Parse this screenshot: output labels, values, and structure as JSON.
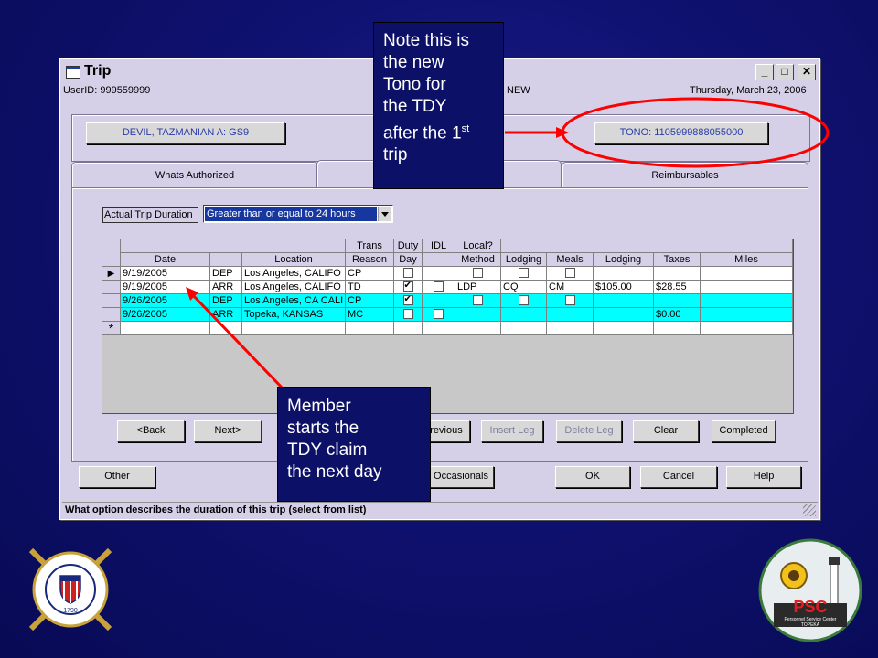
{
  "window": {
    "title": "Trip",
    "user_id": "UserID: 999559999",
    "mode_text": "NEW",
    "date_text": "Thursday, March 23, 2006",
    "member_button": "DEVIL, TAZMANIAN A: GS9",
    "tono_button": "TONO: 1105999888055000",
    "tabs": [
      "Whats Authorized",
      "",
      "Reimbursables"
    ],
    "duration_label": "Actual Trip Duration",
    "duration_value": "Greater than or equal to 24 hours",
    "status_text": "What option describes the duration of this trip (select from list)"
  },
  "grid": {
    "group_headers": {
      "trans": "Trans",
      "duty": "Duty",
      "idl": "IDL",
      "local": "Local?"
    },
    "columns": [
      "Date",
      "",
      "Location",
      "Reason",
      "Day",
      "",
      "Method",
      "Lodging",
      "Meals",
      "Lodging",
      "Taxes",
      "Miles"
    ],
    "rows": [
      {
        "date": "9/19/2005",
        "type": "DEP",
        "location": "Los Angeles,  CALIFO",
        "reason": "CP",
        "duty": false,
        "idl": false,
        "method": "",
        "lodging": "",
        "meals": "",
        "lodging_amt": "",
        "taxes": "",
        "miles": "",
        "checks": [
          false,
          null,
          false,
          false,
          false
        ],
        "highlight": false,
        "current": true
      },
      {
        "date": "9/19/2005",
        "type": "ARR",
        "location": "Los Angeles,  CALIFO",
        "reason": "TD",
        "duty": true,
        "idl": false,
        "method": "LDP",
        "lodging": "CQ",
        "meals": "CM",
        "lodging_amt": "$105.00",
        "taxes": "$28.55",
        "miles": "",
        "checks": [
          true,
          false,
          null,
          null,
          null
        ],
        "highlight": false,
        "current": false
      },
      {
        "date": "9/26/2005",
        "type": "DEP",
        "location": "Los Angeles, CA CALI",
        "reason": "CP",
        "duty": true,
        "idl": false,
        "method": "",
        "lodging": "",
        "meals": "",
        "lodging_amt": "",
        "taxes": "",
        "miles": "",
        "checks": [
          true,
          null,
          false,
          false,
          false
        ],
        "highlight": true,
        "current": false
      },
      {
        "date": "9/26/2005",
        "type": "ARR",
        "location": "Topeka,  KANSAS",
        "reason": "MC",
        "duty": false,
        "idl": false,
        "method": "",
        "lodging": "",
        "meals": "",
        "lodging_amt": "",
        "taxes": "$0.00",
        "miles": "",
        "checks": [
          false,
          false,
          null,
          null,
          null
        ],
        "highlight": true,
        "current": false
      }
    ],
    "new_row_marker": "*",
    "current_row_marker": "▶"
  },
  "nav_buttons": [
    "<Back",
    "Next>",
    "revious",
    "Insert Leg",
    "Delete Leg",
    "Clear",
    "Completed"
  ],
  "bottom_buttons": [
    "Other",
    "Occasionals",
    "OK",
    "Cancel",
    "Help"
  ],
  "callouts": {
    "tono_note": {
      "line1": "Note this is",
      "line2": "the new",
      "line3": "Tono for",
      "line4": "the TDY",
      "line5": "after the 1",
      "sup": "st",
      "line6": "trip"
    },
    "member_note": {
      "line1": "Member",
      "line2": "starts the",
      "line3": "TDY claim",
      "line4": "the next day"
    }
  },
  "logos": {
    "left": {
      "text": "UNITED STATES COAST GUARD",
      "year": "1790"
    },
    "right": {
      "text": "PSC",
      "subtitle": "Personnel Service Center",
      "city": "TOPEKA"
    }
  },
  "colors": {
    "highlight_row": "#00ffff",
    "callout_bg": "#0c1066",
    "annotation_red": "#ff0000",
    "selection_blue": "#1636a0"
  }
}
